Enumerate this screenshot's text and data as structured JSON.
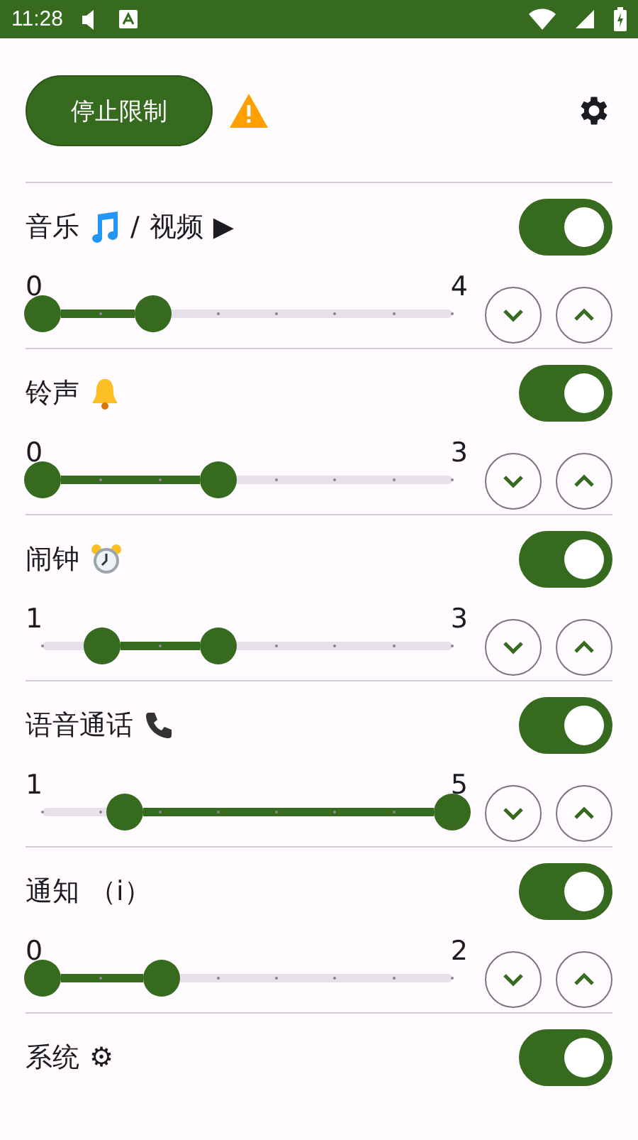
{
  "status_bar": {
    "time": "11:28"
  },
  "header": {
    "button": "停止限制"
  },
  "channels": [
    {
      "label": [
        {
          "kind": "text",
          "text": "音乐"
        },
        {
          "kind": "note"
        },
        {
          "kind": "text",
          "text": "/"
        },
        {
          "kind": "text",
          "text": "视频"
        },
        {
          "kind": "text",
          "text": "▶"
        }
      ],
      "on": true,
      "slider": {
        "min": "0",
        "max": "4",
        "thumbs": [
          {
            "level": 0
          },
          {
            "level": 0.27
          }
        ]
      }
    },
    {
      "label": [
        {
          "kind": "text",
          "text": "铃声"
        },
        {
          "kind": "bell"
        }
      ],
      "on": true,
      "slider": {
        "min": "0",
        "max": "3",
        "thumbs": [
          {
            "level": 0
          },
          {
            "level": 0.43
          }
        ]
      }
    },
    {
      "label": [
        {
          "kind": "text",
          "text": "闹钟"
        },
        {
          "kind": "clock"
        }
      ],
      "on": true,
      "slider": {
        "min": "1",
        "max": "3",
        "thumbs": [
          {
            "level": 0.145
          },
          {
            "level": 0.43
          }
        ]
      }
    },
    {
      "label": [
        {
          "kind": "text",
          "text": "语音通话"
        },
        {
          "kind": "phone"
        }
      ],
      "on": true,
      "slider": {
        "min": "1",
        "max": "5",
        "thumbs": [
          {
            "level": 0.2
          },
          {
            "level": 1
          }
        ]
      }
    },
    {
      "label": [
        {
          "kind": "text",
          "text": "通知"
        },
        {
          "kind": "text",
          "text": "（i）"
        }
      ],
      "on": true,
      "slider": {
        "min": "0",
        "max": "2",
        "thumbs": [
          {
            "level": 0
          },
          {
            "level": 0.29
          }
        ]
      }
    },
    {
      "label": [
        {
          "kind": "text",
          "text": "系统"
        },
        {
          "kind": "text",
          "text": "⚙"
        }
      ],
      "on": true
    }
  ]
}
